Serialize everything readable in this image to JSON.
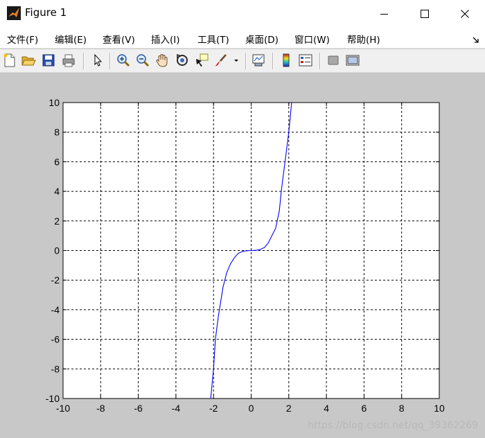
{
  "window": {
    "title": "Figure 1",
    "icons": [
      "matlab-logo-icon",
      "minimize-icon",
      "maximize-icon",
      "close-icon"
    ]
  },
  "menu": {
    "items": [
      "文件(F)",
      "编辑(E)",
      "查看(V)",
      "插入(I)",
      "工具(T)",
      "桌面(D)",
      "窗口(W)",
      "帮助(H)"
    ]
  },
  "toolbar": {
    "icons": [
      "new-figure-icon",
      "open-file-icon",
      "save-icon",
      "print-icon",
      "edit-plot-arrow-icon",
      "zoom-in-icon",
      "zoom-out-icon",
      "pan-hand-icon",
      "rotate-3d-icon",
      "data-cursor-icon",
      "brush-icon",
      "brush-dropdown-icon",
      "link-plot-icon",
      "colorbar-icon",
      "legend-icon",
      "hide-plot-tools-icon",
      "show-plot-tools-icon"
    ]
  },
  "colors": {
    "plot_background": "#ffffff",
    "figure_background": "#c8c8c8",
    "line": "#0000ff",
    "grid": "#000000"
  },
  "chart_data": {
    "type": "line",
    "title": "",
    "xlabel": "",
    "ylabel": "",
    "xlim": [
      -10,
      10
    ],
    "ylim": [
      -10,
      10
    ],
    "xticks": [
      -10,
      -8,
      -6,
      -4,
      -2,
      0,
      2,
      4,
      6,
      8,
      10
    ],
    "yticks": [
      -10,
      -8,
      -6,
      -4,
      -2,
      0,
      2,
      4,
      6,
      8,
      10
    ],
    "grid": true,
    "grid_style": "dashed",
    "series": [
      {
        "color": "#0000ff",
        "x": [
          -2.15,
          -2.0,
          -1.9,
          -1.75,
          -1.5,
          -1.3,
          -1.1,
          -0.9,
          -0.7,
          -0.5,
          -0.3,
          0.0,
          0.3,
          0.5,
          0.7,
          0.9,
          1.1,
          1.3,
          1.5,
          1.6,
          1.8,
          2.0,
          2.1,
          2.15
        ],
        "y": [
          -10.0,
          -8.0,
          -6.0,
          -4.5,
          -2.5,
          -1.5,
          -0.9,
          -0.5,
          -0.2,
          -0.08,
          -0.02,
          0.0,
          0.02,
          0.08,
          0.2,
          0.5,
          1.0,
          1.5,
          2.7,
          4.0,
          6.0,
          8.0,
          9.3,
          10.0
        ]
      }
    ]
  },
  "watermark": "https://blog.csdn.net/qq_39362269"
}
